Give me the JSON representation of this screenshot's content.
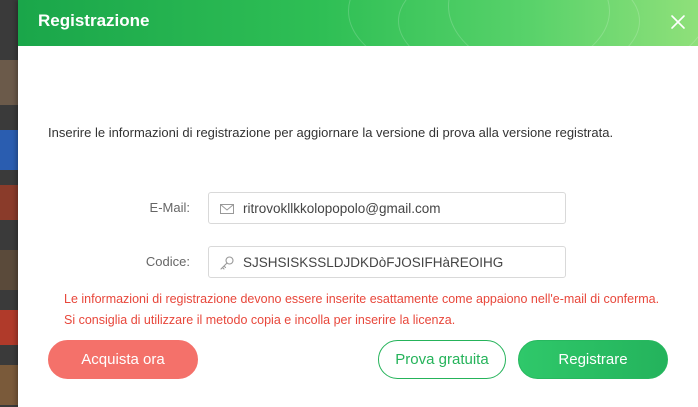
{
  "dialog": {
    "title": "Registrazione",
    "intro": "Inserire le informazioni di registrazione per aggiornare la versione di prova alla versione registrata.",
    "email": {
      "label": "E-Mail:",
      "value": "ritrovokllkkolopopolo@gmail.com",
      "icon": "mail-icon"
    },
    "code": {
      "label": "Codice:",
      "value": "SJSHSISKSSLDJDKDòFJOSIFHàREOIHG",
      "icon": "key-icon"
    },
    "warning": "Le informazioni di registrazione devono essere inserite esattamente come appaiono nell'e-mail di conferma. Si consiglia di utilizzare il metodo copia e incolla per inserire la licenza.",
    "buttons": {
      "buy": "Acquista ora",
      "trial": "Prova gratuita",
      "register": "Registrare"
    }
  },
  "colors": {
    "titlebar": "#2fbf55",
    "warning": "#e8473b",
    "buy": "#f4716a",
    "accent": "#25b35a"
  }
}
